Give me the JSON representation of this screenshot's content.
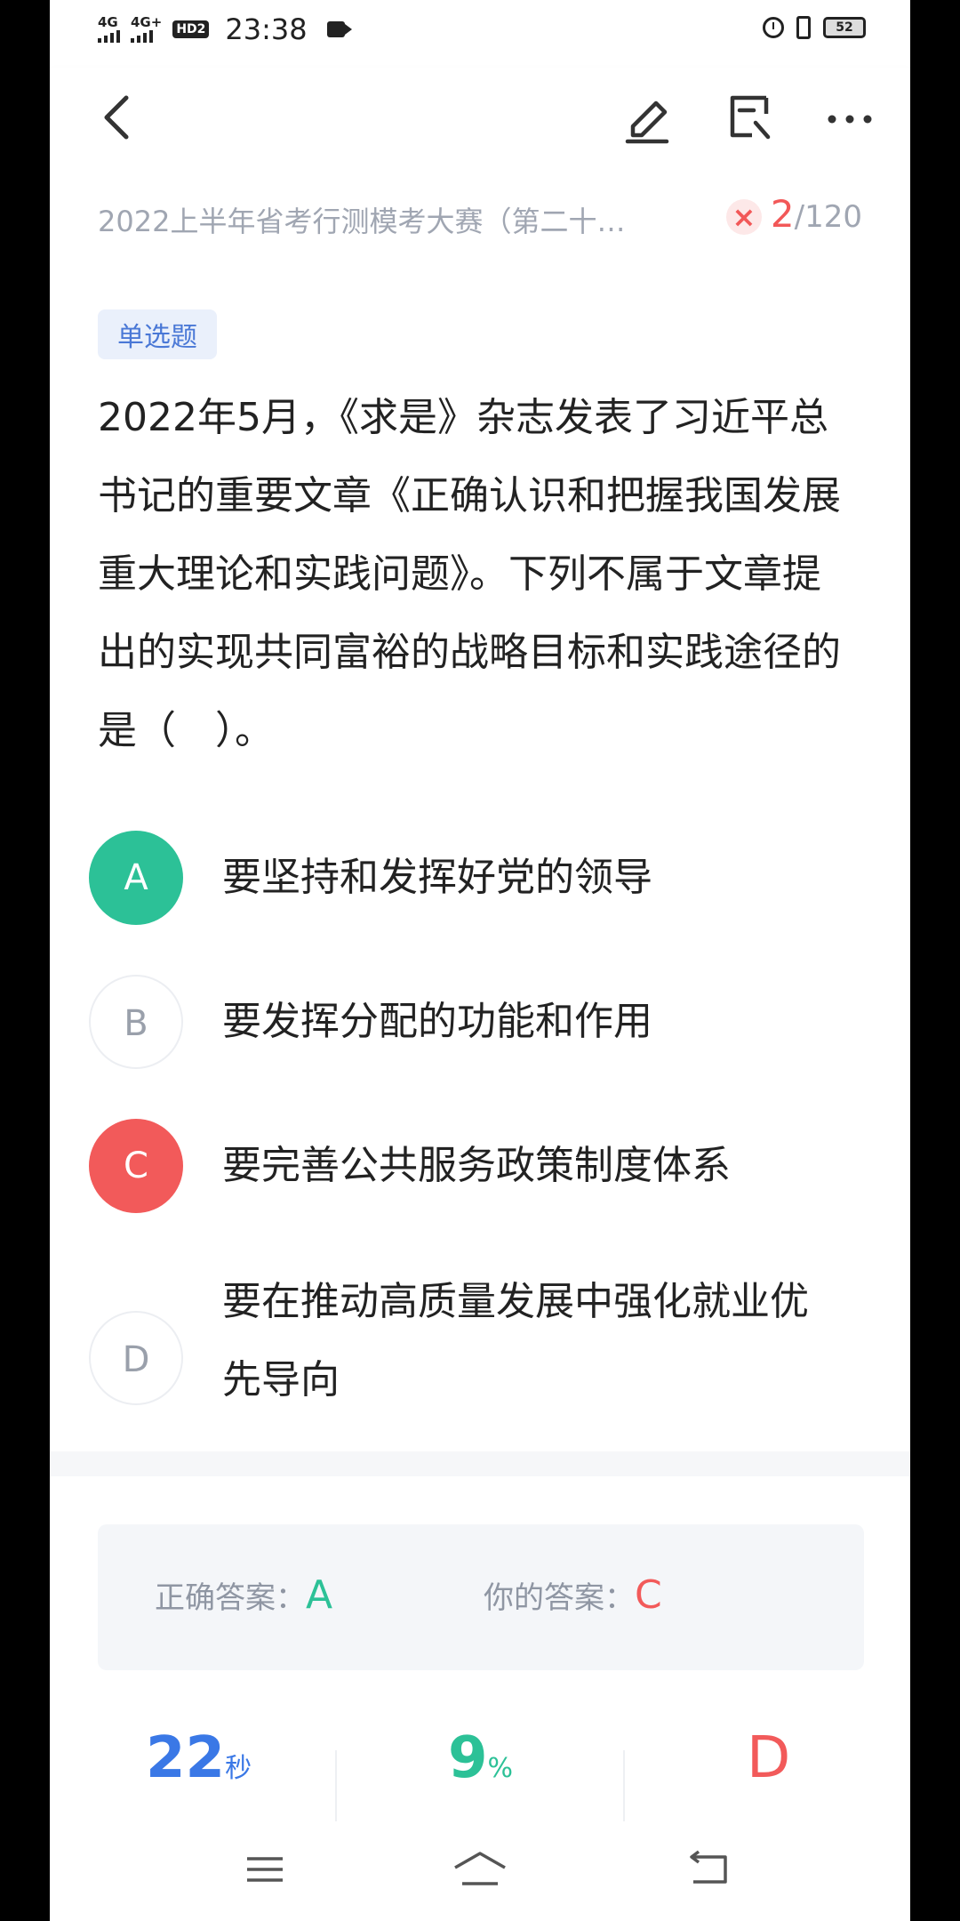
{
  "status_bar": {
    "signal1": "4G",
    "signal2": "4G+",
    "hd": "HD2",
    "time": "23:38",
    "battery": "52",
    "icons": [
      "signal-icon",
      "signal-icon",
      "hd-icon",
      "video-record-icon",
      "alarm-icon",
      "vibrate-icon",
      "battery-icon"
    ]
  },
  "header": {
    "back_icon": "chevron-left-icon",
    "edit_icon": "pencil-icon",
    "note_icon": "note-search-icon",
    "more_icon": "more-dots-icon",
    "subtitle": "2022上半年省考行测模考大赛（第二十…",
    "status_mark": "×",
    "current": "2",
    "total": "/120"
  },
  "question": {
    "type": "单选题",
    "stem": "2022年5月，《求是》杂志发表了习近平总书记的重要文章《正确认识和把握我国发展重大理论和实践问题》。下列不属于文章提出的实现共同富裕的战略目标和实践途径的是（　）。",
    "options": [
      {
        "letter": "A",
        "text": "要坚持和发挥好党的领导",
        "state": "correct"
      },
      {
        "letter": "B",
        "text": "要发挥分配的功能和作用",
        "state": "plain"
      },
      {
        "letter": "C",
        "text": "要完善公共服务政策制度体系",
        "state": "wrong"
      },
      {
        "letter": "D",
        "text": "要在推动高质量发展中强化就业优先导向",
        "state": "plain"
      }
    ]
  },
  "answer": {
    "correct_label": "正确答案：",
    "correct_value": "A",
    "yours_label": "你的答案：",
    "yours_value": "C"
  },
  "stats": {
    "time_value": "22",
    "time_unit": "秒",
    "rate_value": "9",
    "rate_unit": "%",
    "common_wrong": "D"
  },
  "colors": {
    "correct": "#2cc197",
    "wrong": "#f25a5a",
    "blue": "#3a78e6"
  }
}
